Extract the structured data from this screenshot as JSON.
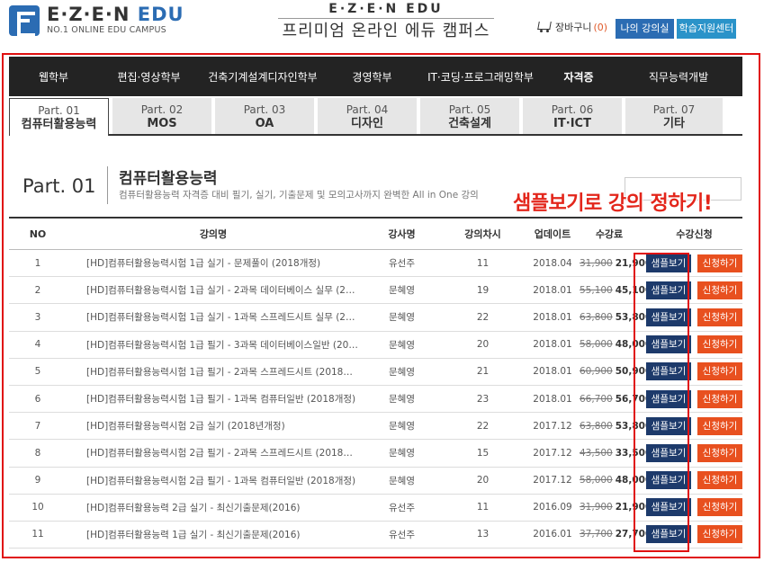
{
  "header": {
    "logo_brand": "E·Z·E·N",
    "logo_edu": "EDU",
    "logo_sub": "NO.1 ONLINE EDU CAMPUS",
    "center_brand": "E·Z·E·N  EDU",
    "center_sub": "프리미엄 온라인 에듀 캠퍼스",
    "cart_label": "장바구니",
    "cart_count": "(0)",
    "my_lecture": "나의 강의실",
    "help_center": "학습지원센터"
  },
  "categories": [
    "웹학부",
    "편집·영상학부",
    "건축기계설계디자인학부",
    "경영학부",
    "IT·코딩·프로그래밍학부",
    "자격증",
    "직무능력개발"
  ],
  "active_category": "자격증",
  "tabs": [
    {
      "num": "Part. 01",
      "name": "컴퓨터활용능력"
    },
    {
      "num": "Part. 02",
      "name": "MOS"
    },
    {
      "num": "Part. 03",
      "name": "OA"
    },
    {
      "num": "Part. 04",
      "name": "디자인"
    },
    {
      "num": "Part. 05",
      "name": "건축설계"
    },
    {
      "num": "Part. 06",
      "name": "IT·ICT"
    },
    {
      "num": "Part. 07",
      "name": "기타"
    }
  ],
  "section": {
    "part": "Part. 01",
    "name": "컴퓨터활용능력",
    "desc": "컴퓨터활용능력 자격증 대비 필기, 실기, 기출문제 및 모의고사까지 완벽한 All in One 강의"
  },
  "callout": "샘플보기로 강의 정하기!",
  "table": {
    "headers": {
      "no": "NO",
      "title": "강의명",
      "teacher": "강사명",
      "count": "강의차시",
      "date": "업데이트",
      "price": "수강료",
      "apply": "수강신청"
    },
    "sample_label": "샘플보기",
    "apply_label": "신청하기",
    "rows": [
      {
        "no": "1",
        "title": "[HD]컴퓨터활용능력시험 1급 실기 - 문제풀이 (2018개정)",
        "teacher": "유선주",
        "count": "11",
        "date": "2018.04",
        "old": "31,900",
        "new": "21,900"
      },
      {
        "no": "2",
        "title": "[HD]컴퓨터활용능력시험 1급 실기 - 2과목 데이터베이스 실무 (201…",
        "teacher": "문혜영",
        "count": "19",
        "date": "2018.01",
        "old": "55,100",
        "new": "45,100"
      },
      {
        "no": "3",
        "title": "[HD]컴퓨터활용능력시험 1급 실기 - 1과목 스프레드시트 실무 (201…",
        "teacher": "문혜영",
        "count": "22",
        "date": "2018.01",
        "old": "63,800",
        "new": "53,800"
      },
      {
        "no": "4",
        "title": "[HD]컴퓨터활용능력시험 1급 필기 - 3과목 데이터베이스일반 (201…",
        "teacher": "문혜영",
        "count": "20",
        "date": "2018.01",
        "old": "58,000",
        "new": "48,000"
      },
      {
        "no": "5",
        "title": "[HD]컴퓨터활용능력시험 1급 필기 - 2과목 스프레드시트 (2018개정)",
        "teacher": "문혜영",
        "count": "21",
        "date": "2018.01",
        "old": "60,900",
        "new": "50,900"
      },
      {
        "no": "6",
        "title": "[HD]컴퓨터활용능력시험 1급 필기 - 1과목 컴퓨터일반 (2018개정)",
        "teacher": "문혜영",
        "count": "23",
        "date": "2018.01",
        "old": "66,700",
        "new": "56,700"
      },
      {
        "no": "7",
        "title": "[HD]컴퓨터활용능력시험 2급 실기 (2018년개정)",
        "teacher": "문혜영",
        "count": "22",
        "date": "2017.12",
        "old": "63,800",
        "new": "53,800"
      },
      {
        "no": "8",
        "title": "[HD]컴퓨터활용능력시험 2급 필기 - 2과목 스프레드시트 (2018년…",
        "teacher": "문혜영",
        "count": "15",
        "date": "2017.12",
        "old": "43,500",
        "new": "33,500"
      },
      {
        "no": "9",
        "title": "[HD]컴퓨터활용능력시험 2급 필기 - 1과목 컴퓨터일반 (2018개정)",
        "teacher": "문혜영",
        "count": "20",
        "date": "2017.12",
        "old": "58,000",
        "new": "48,000"
      },
      {
        "no": "10",
        "title": "[HD]컴퓨터활용능력 2급 실기 - 최신기출문제(2016)",
        "teacher": "유선주",
        "count": "11",
        "date": "2016.09",
        "old": "31,900",
        "new": "21,900"
      },
      {
        "no": "11",
        "title": "[HD]컴퓨터활용능력 1급 실기 - 최신기출문제(2016)",
        "teacher": "유선주",
        "count": "13",
        "date": "2016.01",
        "old": "37,700",
        "new": "27,700"
      }
    ]
  }
}
